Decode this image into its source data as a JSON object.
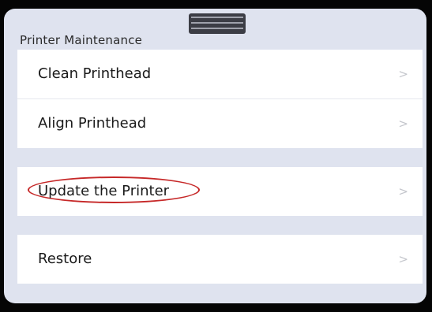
{
  "header": {
    "section_title": "Printer Maintenance"
  },
  "menu": {
    "items": [
      {
        "label": "Clean Printhead",
        "chevron": ">"
      },
      {
        "label": "Align Printhead",
        "chevron": ">"
      },
      {
        "label": "Update the Printer",
        "chevron": ">",
        "highlighted": true
      },
      {
        "label": "Restore",
        "chevron": ">"
      }
    ]
  },
  "colors": {
    "panel_background": "#dfe3ef",
    "row_background": "#ffffff",
    "highlight_circle": "#c62828",
    "screen_border": "#050505"
  }
}
